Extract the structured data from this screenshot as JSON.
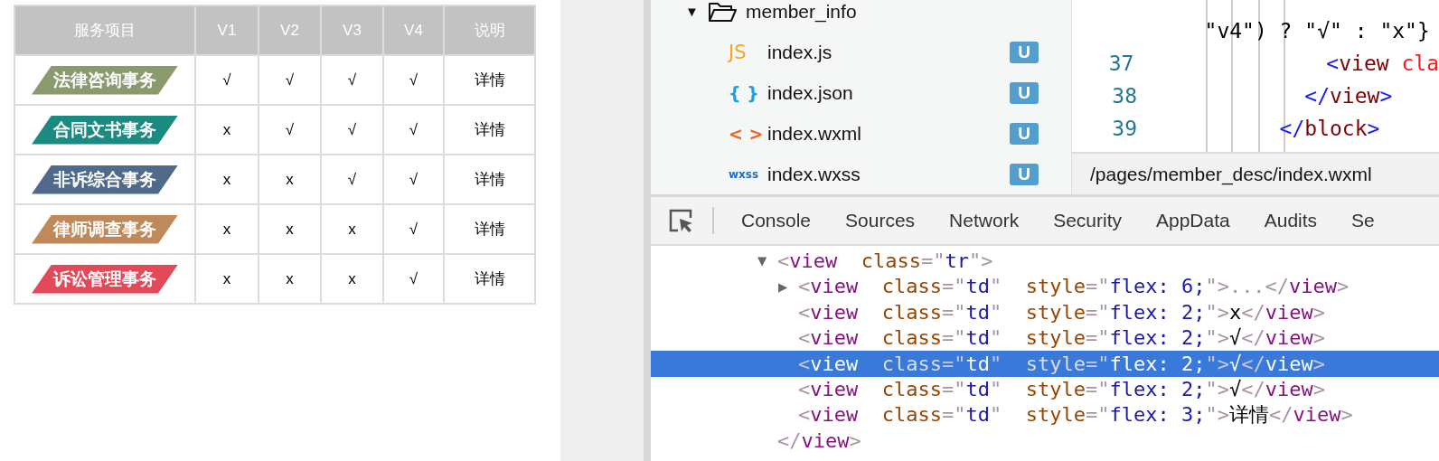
{
  "table": {
    "columns": [
      "服务项目",
      "V1",
      "V2",
      "V3",
      "V4",
      "说明"
    ],
    "rows": [
      {
        "service": "法律咨询事务",
        "color": "#8a9a6e",
        "marks": [
          "√",
          "√",
          "√",
          "√"
        ],
        "detail": "详情"
      },
      {
        "service": "合同文书事务",
        "color": "#1b8a80",
        "marks": [
          "x",
          "√",
          "√",
          "√"
        ],
        "detail": "详情"
      },
      {
        "service": "非诉综合事务",
        "color": "#4f6a8b",
        "marks": [
          "x",
          "x",
          "√",
          "√"
        ],
        "detail": "详情"
      },
      {
        "service": "律师调查事务",
        "color": "#c0895a",
        "marks": [
          "x",
          "x",
          "x",
          "√"
        ],
        "detail": "详情"
      },
      {
        "service": "诉讼管理事务",
        "color": "#e4495a",
        "marks": [
          "x",
          "x",
          "x",
          "√"
        ],
        "detail": "详情"
      }
    ]
  },
  "file_tree": {
    "folder": {
      "toggle": "▼",
      "name": "member_info",
      "expanded": true
    },
    "files": [
      {
        "kind": "js",
        "icon_text": "JS",
        "name": "index.js",
        "badge": "U"
      },
      {
        "kind": "json",
        "icon_text": "{ }",
        "name": "index.json",
        "badge": "U"
      },
      {
        "kind": "wxml",
        "icon_text": "< >",
        "name": "index.wxml",
        "badge": "U"
      },
      {
        "kind": "wxss",
        "icon_text": "wxss",
        "name": "index.wxss",
        "badge": "U"
      }
    ]
  },
  "editor": {
    "lines": [
      {
        "tokens": [
          {
            "kind": "plain",
            "text": "   \"v4\") ? \"√\" : \"x\"}"
          }
        ]
      },
      {
        "number": "37",
        "tokens": [
          {
            "kind": "bracket",
            "text": "             <"
          },
          {
            "kind": "tag",
            "text": "view"
          },
          {
            "kind": "attr",
            "text": " cla"
          }
        ]
      },
      {
        "number": "38",
        "tokens": [
          {
            "kind": "bracket",
            "text": "           </"
          },
          {
            "kind": "tag",
            "text": "view"
          },
          {
            "kind": "bracket",
            "text": ">"
          }
        ]
      },
      {
        "number": "39",
        "tokens": [
          {
            "kind": "bracket",
            "text": "         </"
          },
          {
            "kind": "tag",
            "text": "block"
          },
          {
            "kind": "bracket",
            "text": ">"
          }
        ]
      }
    ],
    "status_path": "/pages/member_desc/index.wxml"
  },
  "devtools": {
    "tabs": [
      {
        "label": "Console",
        "selected": false
      },
      {
        "label": "Sources",
        "selected": false
      },
      {
        "label": "Network",
        "selected": false
      },
      {
        "label": "Security",
        "selected": false
      },
      {
        "label": "AppData",
        "selected": false
      },
      {
        "label": "Audits",
        "selected": false
      },
      {
        "label": "Se",
        "selected": false
      }
    ],
    "nodes": [
      {
        "toggle": "▼",
        "selected": false,
        "children": [
          {
            "toggle": "▶",
            "selected": false,
            "tokens": [
              {
                "kind": "punct",
                "text": "<"
              },
              {
                "kind": "tag",
                "text": "view"
              },
              {
                "kind": "attr",
                "text": "  class"
              },
              {
                "kind": "punct",
                "text": "=\""
              },
              {
                "kind": "value",
                "text": "td"
              },
              {
                "kind": "punct",
                "text": "\""
              },
              {
                "kind": "attr",
                "text": "  style"
              },
              {
                "kind": "punct",
                "text": "=\""
              },
              {
                "kind": "value",
                "text": "flex: 6;"
              },
              {
                "kind": "punct",
                "text": "\">...</"
              },
              {
                "kind": "tag",
                "text": "view"
              },
              {
                "kind": "punct",
                "text": ">"
              }
            ]
          },
          {
            "selected": false,
            "tokens": [
              {
                "kind": "punct",
                "text": "<"
              },
              {
                "kind": "tag",
                "text": "view"
              },
              {
                "kind": "attr",
                "text": "  class"
              },
              {
                "kind": "punct",
                "text": "=\""
              },
              {
                "kind": "value",
                "text": "td"
              },
              {
                "kind": "punct",
                "text": "\""
              },
              {
                "kind": "attr",
                "text": "  style"
              },
              {
                "kind": "punct",
                "text": "=\""
              },
              {
                "kind": "value",
                "text": "flex: 2;"
              },
              {
                "kind": "punct",
                "text": "\">"
              },
              {
                "kind": "text",
                "text": "x"
              },
              {
                "kind": "punct",
                "text": "</"
              },
              {
                "kind": "tag",
                "text": "view"
              },
              {
                "kind": "punct",
                "text": ">"
              }
            ]
          },
          {
            "selected": false,
            "tokens": [
              {
                "kind": "punct",
                "text": "<"
              },
              {
                "kind": "tag",
                "text": "view"
              },
              {
                "kind": "attr",
                "text": "  class"
              },
              {
                "kind": "punct",
                "text": "=\""
              },
              {
                "kind": "value",
                "text": "td"
              },
              {
                "kind": "punct",
                "text": "\""
              },
              {
                "kind": "attr",
                "text": "  style"
              },
              {
                "kind": "punct",
                "text": "=\""
              },
              {
                "kind": "value",
                "text": "flex: 2;"
              },
              {
                "kind": "punct",
                "text": "\">"
              },
              {
                "kind": "text",
                "text": "√"
              },
              {
                "kind": "punct",
                "text": "</"
              },
              {
                "kind": "tag",
                "text": "view"
              },
              {
                "kind": "punct",
                "text": ">"
              }
            ]
          },
          {
            "selected": true,
            "tokens": [
              {
                "kind": "punct",
                "text": "<"
              },
              {
                "kind": "tag",
                "text": "view"
              },
              {
                "kind": "attr",
                "text": "  class"
              },
              {
                "kind": "punct",
                "text": "=\""
              },
              {
                "kind": "value",
                "text": "td"
              },
              {
                "kind": "punct",
                "text": "\""
              },
              {
                "kind": "attr",
                "text": "  style"
              },
              {
                "kind": "punct",
                "text": "=\""
              },
              {
                "kind": "value",
                "text": "flex: 2;"
              },
              {
                "kind": "punct",
                "text": "\">"
              },
              {
                "kind": "text",
                "text": "√"
              },
              {
                "kind": "punct",
                "text": "</"
              },
              {
                "kind": "tag",
                "text": "view"
              },
              {
                "kind": "punct",
                "text": ">"
              }
            ]
          },
          {
            "selected": false,
            "tokens": [
              {
                "kind": "punct",
                "text": "<"
              },
              {
                "kind": "tag",
                "text": "view"
              },
              {
                "kind": "attr",
                "text": "  class"
              },
              {
                "kind": "punct",
                "text": "=\""
              },
              {
                "kind": "value",
                "text": "td"
              },
              {
                "kind": "punct",
                "text": "\""
              },
              {
                "kind": "attr",
                "text": "  style"
              },
              {
                "kind": "punct",
                "text": "=\""
              },
              {
                "kind": "value",
                "text": "flex: 2;"
              },
              {
                "kind": "punct",
                "text": "\">"
              },
              {
                "kind": "text",
                "text": "√"
              },
              {
                "kind": "punct",
                "text": "</"
              },
              {
                "kind": "tag",
                "text": "view"
              },
              {
                "kind": "punct",
                "text": ">"
              }
            ]
          },
          {
            "selected": false,
            "tokens": [
              {
                "kind": "punct",
                "text": "<"
              },
              {
                "kind": "tag",
                "text": "view"
              },
              {
                "kind": "attr",
                "text": "  class"
              },
              {
                "kind": "punct",
                "text": "=\""
              },
              {
                "kind": "value",
                "text": "td"
              },
              {
                "kind": "punct",
                "text": "\""
              },
              {
                "kind": "attr",
                "text": "  style"
              },
              {
                "kind": "punct",
                "text": "=\""
              },
              {
                "kind": "value",
                "text": "flex: 3;"
              },
              {
                "kind": "punct",
                "text": "\">"
              },
              {
                "kind": "text",
                "text": "详情"
              },
              {
                "kind": "punct",
                "text": "</"
              },
              {
                "kind": "tag",
                "text": "view"
              },
              {
                "kind": "punct",
                "text": ">"
              }
            ]
          }
        ],
        "tokens": [
          {
            "kind": "punct",
            "text": "<"
          },
          {
            "kind": "tag",
            "text": "view"
          },
          {
            "kind": "attr",
            "text": "  class"
          },
          {
            "kind": "punct",
            "text": "=\""
          },
          {
            "kind": "value",
            "text": "tr"
          },
          {
            "kind": "punct",
            "text": "\">"
          }
        ]
      },
      {
        "selected": false,
        "tokens": [
          {
            "kind": "punct",
            "text": "</"
          },
          {
            "kind": "tag",
            "text": "view"
          },
          {
            "kind": "punct",
            "text": ">"
          }
        ]
      }
    ]
  }
}
